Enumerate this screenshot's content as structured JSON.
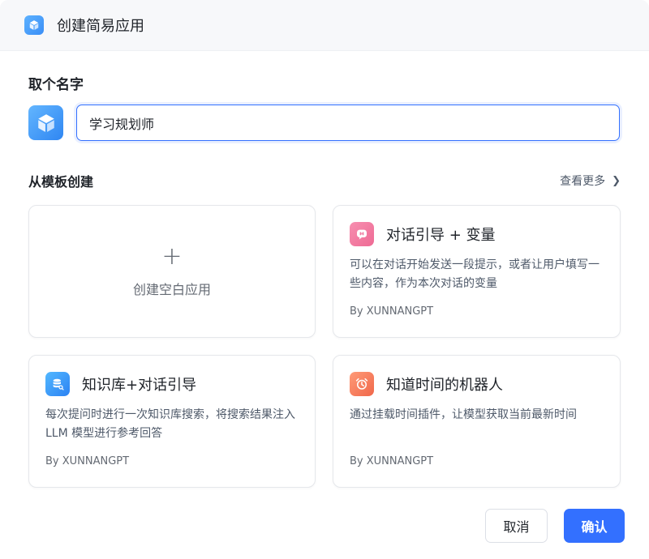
{
  "dialog": {
    "title": "创建简易应用",
    "title_icon": "cube-icon"
  },
  "name_section": {
    "label": "取个名字",
    "avatar_icon": "cube-icon",
    "input_value": "学习规划师"
  },
  "templates": {
    "label": "从模板创建",
    "more_label": "查看更多",
    "blank": {
      "plus": "+",
      "label": "创建空白应用"
    },
    "items": [
      {
        "title": "对话引导 + 变量",
        "description": "可以在对话开始发送一段提示，或者让用户填写一些内容，作为本次对话的变量",
        "author": "By XUNNANGPT",
        "icon": "chat-bubble-icon",
        "color": "#ee6a94"
      },
      {
        "title": "知识库+对话引导",
        "description": "每次提问时进行一次知识库搜索，将搜索结果注入 LLM 模型进行参考回答",
        "author": "By XUNNANGPT",
        "icon": "database-search-icon",
        "color": "#2b82f3"
      },
      {
        "title": "知道时间的机器人",
        "description": "通过挂载时间插件，让模型获取当前最新时间",
        "author": "By XUNNANGPT",
        "icon": "alarm-clock-icon",
        "color": "#f0674a"
      }
    ]
  },
  "footer": {
    "cancel_label": "取消",
    "confirm_label": "确认"
  },
  "colors": {
    "primary": "#3370ff",
    "header_bg": "#f7f8fa"
  }
}
